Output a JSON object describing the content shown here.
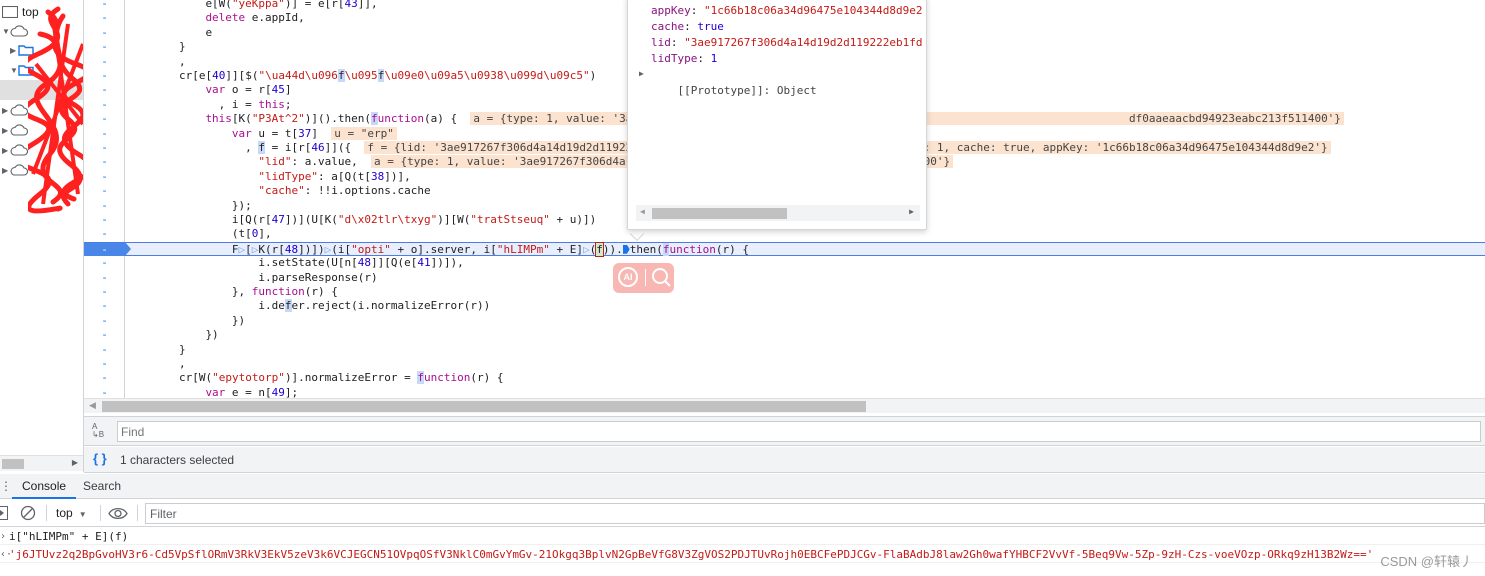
{
  "navigator": {
    "items": [
      {
        "label": "top",
        "icon": "frame-icon",
        "indent": 0,
        "expanded": null
      },
      {
        "label": "",
        "icon": "cloud-icon",
        "indent": 1,
        "expanded": true
      },
      {
        "label": "",
        "icon": "folder-icon",
        "indent": 2,
        "expanded": false
      },
      {
        "label": "",
        "icon": "folder-icon",
        "indent": 2,
        "expanded": true
      },
      {
        "label": "",
        "icon": "file-icon",
        "indent": 3,
        "expanded": null,
        "selected": true
      },
      {
        "label": "",
        "icon": "cloud-icon",
        "indent": 1,
        "expanded": false
      },
      {
        "label": "",
        "icon": "cloud-icon",
        "indent": 1,
        "expanded": false
      },
      {
        "label": "",
        "icon": "cloud-icon",
        "indent": 1,
        "expanded": false
      },
      {
        "label": "",
        "icon": "cloud-icon",
        "indent": 1,
        "expanded": false
      }
    ],
    "redacted": true
  },
  "editor": {
    "gutter_marker": "-",
    "lines": [
      {
        "indent": 12,
        "tokens": [
          [
            "p",
            "e[W("
          ],
          [
            "s",
            "\"yeKppa\""
          ],
          [
            "p",
            ")] = e[r["
          ],
          [
            "n",
            "43"
          ],
          [
            "p",
            "]],"
          ]
        ]
      },
      {
        "indent": 12,
        "tokens": [
          [
            "k",
            "delete"
          ],
          [
            "p",
            " e.appId,"
          ]
        ]
      },
      {
        "indent": 12,
        "tokens": [
          [
            "p",
            "e"
          ]
        ]
      },
      {
        "indent": 8,
        "tokens": [
          [
            "p",
            "}"
          ]
        ]
      },
      {
        "indent": 8,
        "tokens": [
          [
            "p",
            ","
          ]
        ]
      },
      {
        "indent": 8,
        "tokens": [
          [
            "p",
            "cr[e["
          ],
          [
            "n",
            "40"
          ],
          [
            "p",
            "]][$("
          ],
          [
            "s",
            "\"\\ua44d\\u096"
          ],
          [
            "hl",
            "f"
          ],
          [
            "s",
            "\\u095"
          ],
          [
            "hl",
            "f"
          ],
          [
            "s",
            "\\u09e0\\u09a5\\u0938\\u099d\\u09c5\""
          ],
          [
            "p",
            ")"
          ]
        ]
      },
      {
        "indent": 12,
        "tokens": [
          [
            "k",
            "var"
          ],
          [
            "p",
            " o = r["
          ],
          [
            "n",
            "45"
          ],
          [
            "p",
            "]"
          ]
        ]
      },
      {
        "indent": 14,
        "tokens": [
          [
            "p",
            ", i = "
          ],
          [
            "k",
            "this"
          ],
          [
            "p",
            ";"
          ]
        ]
      },
      {
        "indent": 12,
        "tokens": [
          [
            "k",
            "this"
          ],
          [
            "p",
            "[K("
          ],
          [
            "s",
            "\"P3At^2\""
          ],
          [
            "p",
            ")]().then("
          ],
          [
            "hlk",
            "f"
          ],
          [
            "k",
            "unction"
          ],
          [
            "p",
            "(a) {  "
          ],
          [
            "inl",
            "a = {type: 1, value: '3ae917267f306d4a14d19d2d119222eb1fd                                          df0aaeaacbd94923eabc213f511400'}"
          ]
        ]
      },
      {
        "indent": 16,
        "tokens": [
          [
            "k",
            "var"
          ],
          [
            "p",
            " u = t["
          ],
          [
            "n",
            "37"
          ],
          [
            "p",
            "]  "
          ],
          [
            "inl",
            "u = \"erp\""
          ]
        ]
      },
      {
        "indent": 18,
        "tokens": [
          [
            "p",
            ", "
          ],
          [
            "hl",
            "f"
          ],
          [
            "p",
            " = i[r["
          ],
          [
            "n",
            "46"
          ],
          [
            "p",
            "]]({  "
          ],
          [
            "inl",
            "f = {lid: '3ae917267f306d4a14d19d2d119222eb1fd0aaeaacbd94923eabc213f511400', lidType: 1, cache: true, appKey: '1c66b18c06a34d96475e104344d8d9e2'}"
          ]
        ]
      },
      {
        "indent": 20,
        "tokens": [
          [
            "s",
            "\"lid\""
          ],
          [
            "p",
            ": a.value,  "
          ],
          [
            "inl",
            "a = {type: 1, value: '3ae917267f306d4a14d19d2d119222eb1fd0aaeaacbd94923eabc213f511400'}"
          ]
        ]
      },
      {
        "indent": 20,
        "tokens": [
          [
            "s",
            "\"lidType\""
          ],
          [
            "p",
            ": a[Q(t["
          ],
          [
            "n",
            "38"
          ],
          [
            "p",
            "])],"
          ]
        ]
      },
      {
        "indent": 20,
        "tokens": [
          [
            "s",
            "\"cache\""
          ],
          [
            "p",
            ": !!i.options.cache"
          ]
        ]
      },
      {
        "indent": 16,
        "tokens": [
          [
            "p",
            "});"
          ]
        ]
      },
      {
        "indent": 16,
        "tokens": [
          [
            "p",
            "i[Q(r["
          ],
          [
            "n",
            "47"
          ],
          [
            "p",
            "])](U[K("
          ],
          [
            "s",
            "\"d\\x02tlr\\txyg\""
          ],
          [
            "p",
            ")][W("
          ],
          [
            "s",
            "\"tratStseuq\""
          ],
          [
            "p",
            " + u)])"
          ]
        ]
      },
      {
        "indent": 16,
        "tokens": [
          [
            "p",
            "(t["
          ],
          [
            "n",
            "0"
          ],
          [
            "p",
            "],"
          ]
        ]
      },
      {
        "indent": 16,
        "active": true,
        "tokens": [
          [
            "p",
            "F"
          ],
          [
            "bpm",
            "▷"
          ],
          [
            "p",
            "["
          ],
          [
            "bpm",
            "▷"
          ],
          [
            "p",
            "K(r["
          ],
          [
            "n",
            "48"
          ],
          [
            "p",
            "])])"
          ],
          [
            "bpm",
            "▷"
          ],
          [
            "p",
            "(i["
          ],
          [
            "s",
            "\"opti\""
          ],
          [
            "p",
            " + o].server, i["
          ],
          [
            "s",
            "\"hLIMPm\""
          ],
          [
            "p",
            " + E]"
          ],
          [
            "bpm",
            "▷"
          ],
          [
            "p",
            "("
          ],
          [
            "cur",
            "f"
          ],
          [
            "p",
            "))."
          ],
          [
            "bps",
            ""
          ],
          [
            "p",
            "then("
          ],
          [
            "hlk",
            "f"
          ],
          [
            "k",
            "unction"
          ],
          [
            "p",
            "(r) {"
          ]
        ]
      },
      {
        "indent": 20,
        "tokens": [
          [
            "p",
            "i.setState(U[n["
          ],
          [
            "n",
            "48"
          ],
          [
            "p",
            "]][Q(e["
          ],
          [
            "n",
            "41"
          ],
          [
            "p",
            "])]),"
          ]
        ]
      },
      {
        "indent": 20,
        "tokens": [
          [
            "p",
            "i.parseResponse(r)"
          ]
        ]
      },
      {
        "indent": 16,
        "tokens": [
          [
            "p",
            "}, "
          ],
          [
            "k",
            "function"
          ],
          [
            "p",
            "(r) {"
          ]
        ]
      },
      {
        "indent": 20,
        "tokens": [
          [
            "p",
            "i.de"
          ],
          [
            "hl",
            "f"
          ],
          [
            "p",
            "er.reject(i.normalizeError(r))"
          ]
        ]
      },
      {
        "indent": 16,
        "tokens": [
          [
            "p",
            "})"
          ]
        ]
      },
      {
        "indent": 12,
        "tokens": [
          [
            "p",
            "})"
          ]
        ]
      },
      {
        "indent": 8,
        "tokens": [
          [
            "p",
            "}"
          ]
        ]
      },
      {
        "indent": 8,
        "tokens": [
          [
            "p",
            ","
          ]
        ]
      },
      {
        "indent": 8,
        "tokens": [
          [
            "p",
            "cr[W("
          ],
          [
            "s",
            "\"epytotorp\""
          ],
          [
            "p",
            ")].normalizeError = "
          ],
          [
            "hlk",
            "f"
          ],
          [
            "k",
            "unction"
          ],
          [
            "p",
            "(r) {"
          ]
        ]
      },
      {
        "indent": 12,
        "tokens": [
          [
            "k",
            "var"
          ],
          [
            "p",
            " e = n["
          ],
          [
            "n",
            "49"
          ],
          [
            "p",
            "];"
          ]
        ]
      }
    ]
  },
  "popover": {
    "props": [
      {
        "key": "appKey",
        "value": "\"1c66b18c06a34d96475e104344d8d9e2",
        "type": "string"
      },
      {
        "key": "cache",
        "value": "true",
        "type": "bool"
      },
      {
        "key": "lid",
        "value": "\"3ae917267f306d4a14d19d2d119222eb1fd",
        "type": "string"
      },
      {
        "key": "lidType",
        "value": "1",
        "type": "number"
      }
    ],
    "prototype_label": "[[Prototype]]: Object"
  },
  "findbar": {
    "placeholder": "Find",
    "value": ""
  },
  "statusbar": {
    "icon": "pretty-print-icon",
    "text": "1 characters selected"
  },
  "drawer": {
    "tabs": [
      {
        "label": "Console",
        "active": true
      },
      {
        "label": "Search",
        "active": false
      }
    ]
  },
  "console_toolbar": {
    "context": "top",
    "filter_placeholder": "Filter",
    "filter_value": ""
  },
  "console": {
    "entries": [
      {
        "kind": "input",
        "prompt": "›",
        "text": "i[\"hLIMPm\" + E](f)"
      },
      {
        "kind": "result",
        "prompt": "‹·",
        "text": "'j6JTUvz2q2BpGvoHV3r6-Cd5VpSflORmV3RkV3EkV5zeV3k6VCJEGCN51OVpqOSfV3NklC0mGvYmGv-21Okgq3BplvN2GpBeVfG8V3ZgVOS2PDJTUvRojh0EBCFePDJCGv-FlaBAdbJ8law2Gh0wafYHBCF2VvVf-5Beq9Vw-5Zp-9zH-Czs-voeVOzp-ORkq9zH13B2Wz=='"
      }
    ]
  },
  "ai_widget": {
    "ai_label": "AI"
  },
  "watermark": "CSDN @轩辕丿",
  "colors": {
    "keyword": "#aa0d91",
    "string": "#c41a16",
    "number": "#1c00cf",
    "active_line_bg": "#e8eefc",
    "breakpoint": "#4a86e8",
    "inline_value_bg": "#fbe3d0",
    "accent": "#1a73e8"
  }
}
